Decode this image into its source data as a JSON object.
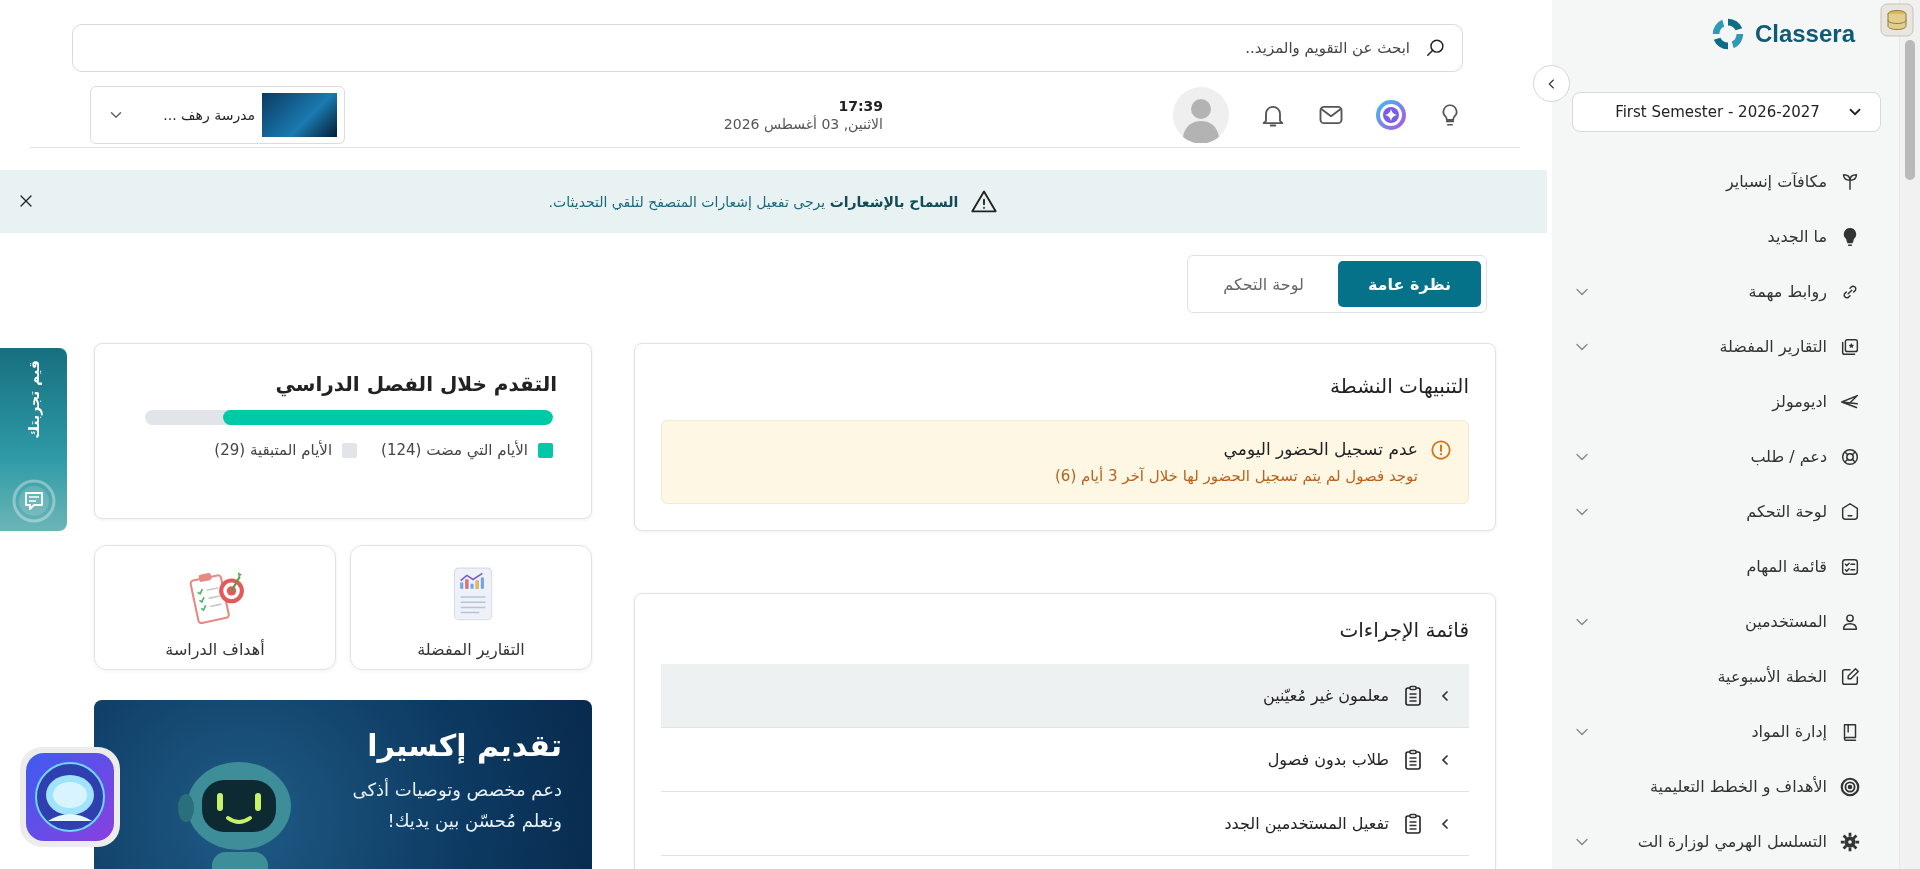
{
  "header": {
    "search": {
      "placeholder": "ابحث عن التقويم والمزيد.."
    },
    "time": "17:39",
    "date": "الاثنين, 03 أغسطس 2026",
    "school": "مدرسة رهف ..."
  },
  "banner": {
    "message": "**السماح بالإشعارات** يرجى تفعيل إشعارات المتصفح لتلقي التحديثات."
  },
  "tabs": [
    {
      "label": "نظرة عامة",
      "selected": true
    },
    {
      "label": "لوحة التحكم",
      "selected": false
    }
  ],
  "alerts": {
    "title": "التنبيهات النشطة",
    "items": [
      {
        "title": "عدم تسجيل الحضور اليومي",
        "message": "توجد فصول لم يتم تسجيل الحضور لها خلال آخر 3 أيام (6)"
      }
    ]
  },
  "actions": {
    "title": "قائمة الإجراءات",
    "items": [
      {
        "label": "معلمون غير مُعيّنين",
        "hovered": true
      },
      {
        "label": "طلاب بدون فصول",
        "hovered": false
      },
      {
        "label": "تفعيل المستخدمين الجدد",
        "hovered": false
      }
    ]
  },
  "progress": {
    "title": "التقدم خلال الفصل الدراسي",
    "level": 0.81,
    "legend": [
      {
        "label": "الأيام التي مضت (124)",
        "color": "#00c9a7"
      },
      {
        "label": "الأيام المتبقية (29)",
        "color": "#e1e4e8"
      }
    ]
  },
  "shortcuts": [
    {
      "label": "التقارير المفضلة"
    },
    {
      "label": "أهداف الدراسة"
    }
  ],
  "promo": {
    "title": "تقديم إكسيرا",
    "text": "دعم مخصص وتوصيات أذكى\nوتعلم مُحسّن بين يديك!"
  },
  "feedback": {
    "label": "قيم تجربتك"
  },
  "sidebar": {
    "logo": "Classera",
    "semester": "First Semester - 2026-2027",
    "items": [
      {
        "label": "مكافآت إنسباير",
        "has_submenu": false
      },
      {
        "label": "ما الجديد",
        "has_submenu": false
      },
      {
        "label": "روابط مهمة",
        "has_submenu": true
      },
      {
        "label": "التقارير المفضلة",
        "has_submenu": true
      },
      {
        "label": "اديومولز",
        "has_submenu": false
      },
      {
        "label": "دعم / طلب",
        "has_submenu": true
      },
      {
        "label": "لوحة التحكم",
        "has_submenu": true
      },
      {
        "label": "قائمة المهام",
        "has_submenu": false
      },
      {
        "label": "المستخدمين",
        "has_submenu": true
      },
      {
        "label": "الخطة الأسبوعية",
        "has_submenu": false
      },
      {
        "label": "إدارة المواد",
        "has_submenu": true
      },
      {
        "label": "الأهداف و الخطط التعليمية",
        "has_submenu": false
      },
      {
        "label": "التسلسل الهرمي لوزارة الت",
        "has_submenu": true
      }
    ]
  }
}
